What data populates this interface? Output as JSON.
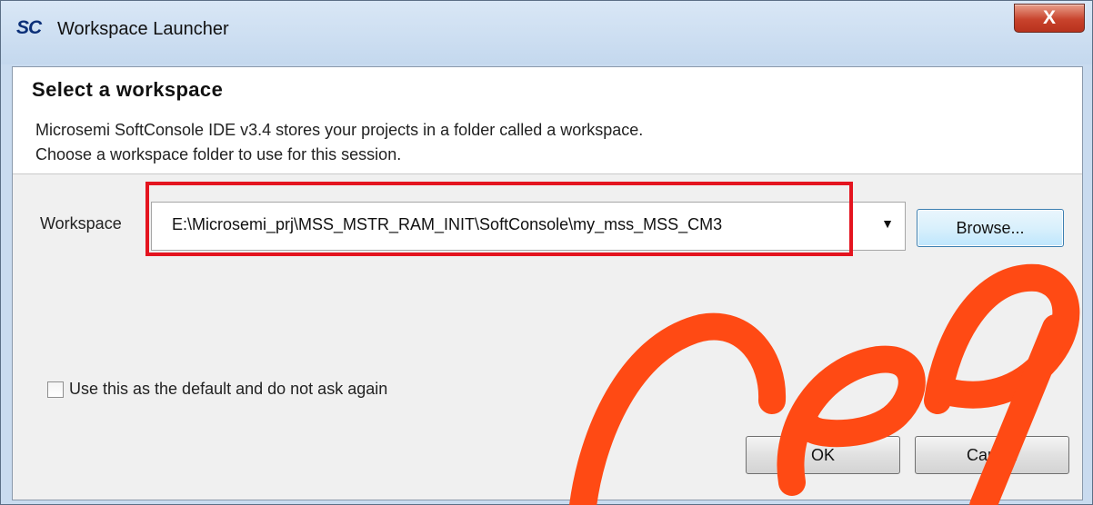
{
  "window": {
    "app_logo": "SC",
    "title": "Workspace Launcher",
    "close_glyph": "X"
  },
  "header": {
    "title": "Select a workspace",
    "description_line1": "Microsemi SoftConsole IDE v3.4 stores your projects in a folder called a workspace.",
    "description_line2": "Choose a workspace folder to use for this session."
  },
  "workspace": {
    "label": "Workspace",
    "value": "E:\\Microsemi_prj\\MSS_MSTR_RAM_INIT\\SoftConsole\\my_mss_MSS_CM3",
    "dropdown_glyph": "▼",
    "browse_label": "Browse..."
  },
  "default_checkbox": {
    "label": "Use this as the default and do not ask again",
    "checked": false
  },
  "buttons": {
    "ok_label": "OK",
    "cancel_label": "Cancel"
  },
  "colors": {
    "highlight_border": "#e4141f",
    "watermark": "#ff4a14"
  },
  "icons": {
    "close": "close-icon",
    "dropdown": "chevron-down-icon",
    "app": "softconsole-logo"
  }
}
